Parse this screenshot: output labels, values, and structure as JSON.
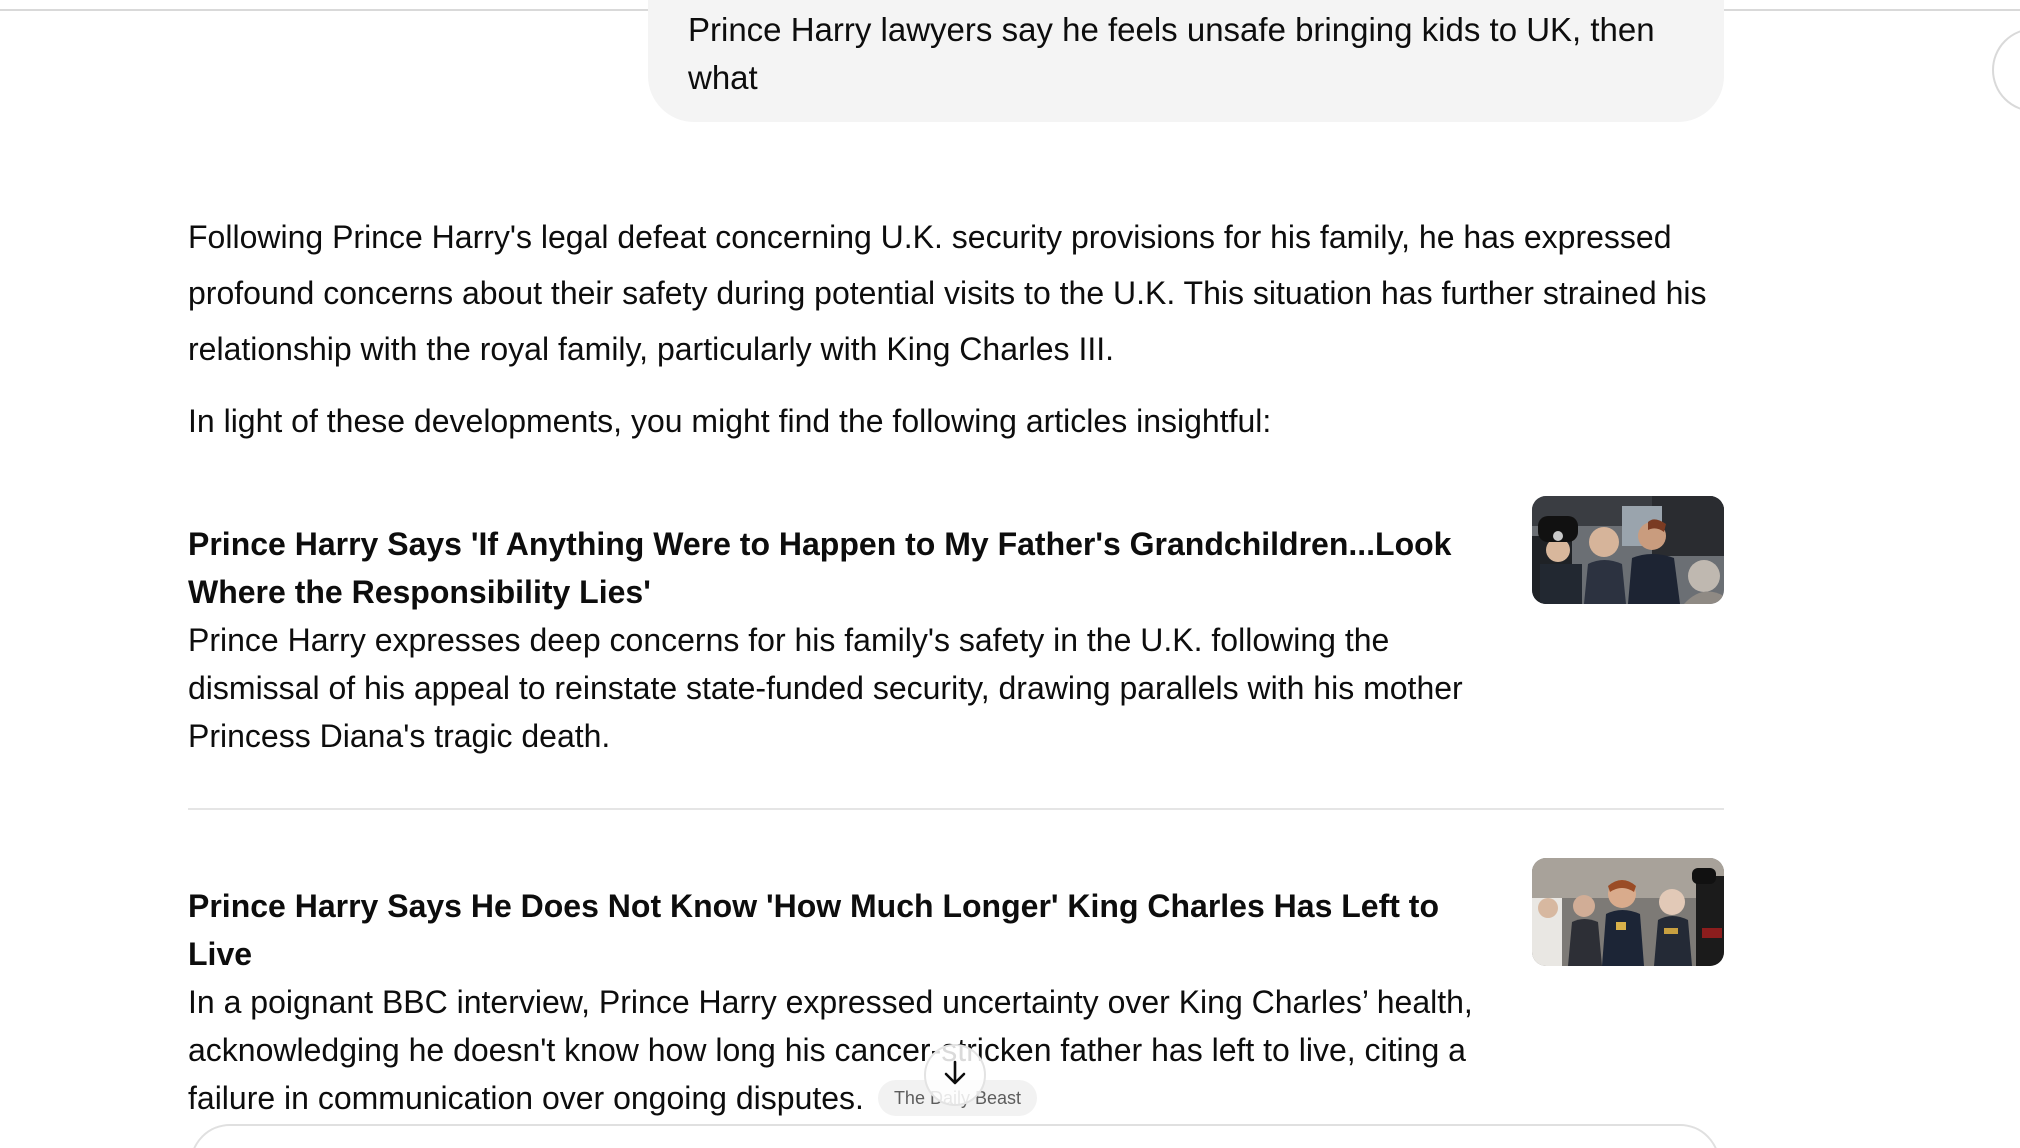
{
  "user_message": {
    "text": "Prince Harry lawyers say he feels unsafe bringing kids to UK, then what"
  },
  "response": {
    "intro": "Following Prince Harry's legal defeat concerning U.K. security provisions for his family, he has expressed profound concerns about their safety during potential visits to the U.K. This situation has further strained his relationship with the royal family, particularly with King Charles III.",
    "lead_in": "In light of these developments, you might find the following articles insightful:",
    "articles": [
      {
        "title": "Prince Harry Says 'If Anything Were to Happen to My Father's Grandchildren...Look Where the Responsibility Lies'",
        "summary": "Prince Harry expresses deep concerns for his family's safety in the U.K. following the dismissal of his appeal to reinstate state-funded security, drawing parallels with his mother Princess Diana's tragic death.",
        "thumbnail_icon": "news-photo-thumbnail"
      },
      {
        "title": "Prince Harry Says He Does Not Know 'How Much Longer' King Charles Has Left to Live",
        "summary": "In a poignant BBC interview, Prince Harry expressed uncertainty over King Charles’ health, acknowledging he doesn't know how long his cancer-stricken father has left to live, citing a failure in communication over ongoing disputes.",
        "source": "The Daily Beast",
        "thumbnail_icon": "news-photo-thumbnail"
      }
    ]
  },
  "controls": {
    "scroll_down_icon": "arrow-down-icon"
  }
}
